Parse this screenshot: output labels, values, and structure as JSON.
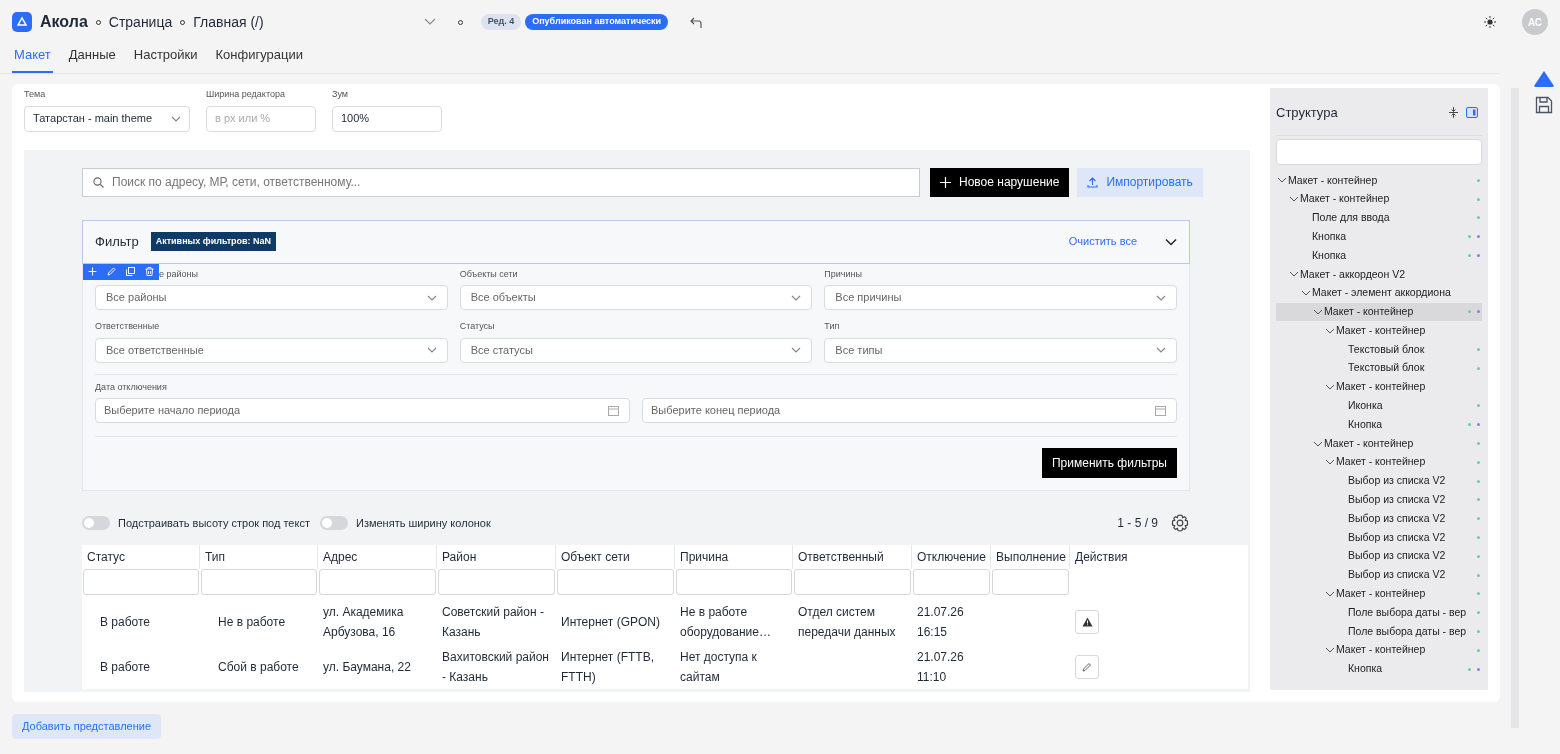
{
  "header": {
    "app_name": "Акола",
    "breadcrumbs": [
      "Страница",
      "Главная (/)"
    ],
    "revision": "Ред. 4",
    "status": "Опубликован автоматически",
    "avatar": "АС"
  },
  "tabs": [
    {
      "label": "Макет",
      "selected": true
    },
    {
      "label": "Данные",
      "selected": false
    },
    {
      "label": "Настройки",
      "selected": false
    },
    {
      "label": "Конфигурации",
      "selected": false
    }
  ],
  "editor_settings": [
    {
      "label": "Тема",
      "kind": "select",
      "value": "Татарстан - main theme"
    },
    {
      "label": "Ширина редактора",
      "kind": "input",
      "placeholder": "в px или %"
    },
    {
      "label": "Зум",
      "kind": "input",
      "value": "100%"
    }
  ],
  "canvas": {
    "search": {
      "placeholder": "Поиск по адресу, МР, сети, ответственному..."
    },
    "buttons": [
      {
        "label": "Новое нарушение",
        "kind": "primary"
      },
      {
        "label": "Импортировать",
        "kind": "secondary"
      }
    ],
    "filter": {
      "title": "Фильтр",
      "badge": "Активных фильтров: NaN",
      "clear": "Очистить все",
      "expanded": true,
      "fields": [
        {
          "label": "е районы",
          "placeholder": "Все районы"
        },
        {
          "label": "Объекты сети",
          "placeholder": "Все объекты"
        },
        {
          "label": "Причины",
          "placeholder": "Все причины"
        },
        {
          "label": "Ответственные",
          "placeholder": "Все ответственные"
        },
        {
          "label": "Статусы",
          "placeholder": "Все статусы"
        },
        {
          "label": "Тип",
          "placeholder": "Все типы"
        }
      ],
      "date": {
        "label": "Дата отключения",
        "fields": [
          {
            "placeholder": "Выберите начало периода"
          },
          {
            "placeholder": "Выберите конец периода"
          }
        ]
      },
      "apply": "Применить фильтры"
    },
    "toggles": [
      {
        "label": "Подстраивать высоту строк под текст",
        "on": false
      },
      {
        "label": "Изменять ширину колонок",
        "on": false
      }
    ],
    "pagination": "1 - 5 / 9",
    "table": {
      "columns": [
        "Статус",
        "Тип",
        "Адрес",
        "Район",
        "Объект сети",
        "Причина",
        "Ответственный",
        "Отключение",
        "Выполнение",
        "Действия"
      ],
      "rows": [
        {
          "cells": [
            "В работе",
            "Не в работе",
            "ул. Академика Арбузова, 16",
            "Советский район - Казань",
            "Интернет (GPON)",
            "Не в работе оборудование…",
            "Отдел систем передачи данных",
            "21.07.26 16:15",
            ""
          ],
          "kind": "warning"
        },
        {
          "cells": [
            "В работе",
            "Сбой в работе",
            "ул. Баумана, 22",
            "Вахитовский район - Казань",
            "Интернет (FTTB, FTTH)",
            "Нет доступа к сайтам",
            "",
            "21.07.26 11:10",
            ""
          ],
          "kind": "edit"
        }
      ]
    }
  },
  "structure": {
    "title": "Структура",
    "tree": [
      {
        "label": "Макет - контейнер",
        "expanded": true,
        "selected": false,
        "markers": [
          {
            "color": "#5fd3a8"
          }
        ],
        "children": [
          {
            "label": "Макет - контейнер",
            "expanded": true,
            "selected": false,
            "markers": [
              {
                "color": "#5fd3a8"
              }
            ],
            "children": [
              {
                "label": "Поле для ввода",
                "selected": false,
                "markers": [
                  {
                    "color": "#5fd3a8"
                  }
                ]
              },
              {
                "label": "Кнопка",
                "selected": false,
                "markers": [
                  {
                    "color": "#5fd3a8"
                  },
                  {
                    "color": "#8a7cf0"
                  }
                ]
              },
              {
                "label": "Кнопка",
                "selected": false,
                "markers": [
                  {
                    "color": "#5fd3a8"
                  },
                  {
                    "color": "#8a7cf0"
                  }
                ]
              }
            ]
          },
          {
            "label": "Макет - аккордеон V2",
            "expanded": true,
            "selected": false,
            "children": [
              {
                "label": "Макет - элемент аккордиона",
                "expanded": true,
                "selected": false,
                "children": [
                  {
                    "label": "Макет - контейнер",
                    "expanded": true,
                    "selected": true,
                    "markers": [
                      {
                        "color": "#5fd3a8"
                      },
                      {
                        "color": "#8a7cf0"
                      }
                    ],
                    "children": [
                      {
                        "label": "Макет - контейнер",
                        "expanded": true,
                        "selected": false,
                        "children": [
                          {
                            "label": "Текстовый блок",
                            "selected": false,
                            "markers": [
                              {
                                "color": "#5fd3a8"
                              }
                            ]
                          },
                          {
                            "label": "Текстовый блок",
                            "selected": false,
                            "markers": [
                              {
                                "color": "#5fd3a8"
                              }
                            ]
                          }
                        ]
                      },
                      {
                        "label": "Макет - контейнер",
                        "expanded": true,
                        "selected": false,
                        "children": [
                          {
                            "label": "Иконка",
                            "selected": false,
                            "markers": [
                              {
                                "color": "#5fd3a8"
                              }
                            ]
                          },
                          {
                            "label": "Кнопка",
                            "selected": false,
                            "markers": [
                              {
                                "color": "#5fd3a8"
                              },
                              {
                                "color": "#8a7cf0"
                              }
                            ]
                          }
                        ]
                      }
                    ]
                  },
                  {
                    "label": "Макет - контейнер",
                    "expanded": true,
                    "selected": false,
                    "markers": [
                      {
                        "color": "#5fd3a8"
                      }
                    ],
                    "children": [
                      {
                        "label": "Макет - контейнер",
                        "expanded": true,
                        "selected": false,
                        "markers": [
                          {
                            "color": "#5fd3a8"
                          }
                        ],
                        "children": [
                          {
                            "label": "Выбор из списка V2",
                            "selected": false,
                            "markers": [
                              {
                                "color": "#5fd3a8"
                              }
                            ]
                          },
                          {
                            "label": "Выбор из списка V2",
                            "selected": false,
                            "markers": [
                              {
                                "color": "#5fd3a8"
                              }
                            ]
                          },
                          {
                            "label": "Выбор из списка V2",
                            "selected": false,
                            "markers": [
                              {
                                "color": "#5fd3a8"
                              }
                            ]
                          },
                          {
                            "label": "Выбор из списка V2",
                            "selected": false,
                            "markers": [
                              {
                                "color": "#5fd3a8"
                              }
                            ]
                          },
                          {
                            "label": "Выбор из списка V2",
                            "selected": false,
                            "markers": [
                              {
                                "color": "#5fd3a8"
                              }
                            ]
                          },
                          {
                            "label": "Выбор из списка V2",
                            "selected": false,
                            "markers": [
                              {
                                "color": "#5fd3a8"
                              }
                            ]
                          }
                        ]
                      },
                      {
                        "label": "Макет - контейнер",
                        "expanded": true,
                        "selected": false,
                        "markers": [
                          {
                            "color": "#5fd3a8"
                          }
                        ],
                        "children": [
                          {
                            "label": "Поле выбора даты - вер",
                            "selected": false,
                            "markers": [
                              {
                                "color": "#5fd3a8"
                              }
                            ]
                          },
                          {
                            "label": "Поле выбора даты - вер",
                            "selected": false,
                            "markers": [
                              {
                                "color": "#5fd3a8"
                              }
                            ]
                          }
                        ]
                      },
                      {
                        "label": "Макет - контейнер",
                        "expanded": true,
                        "selected": false,
                        "markers": [
                          {
                            "color": "#5fd3a8"
                          }
                        ],
                        "children": [
                          {
                            "label": "Кнопка",
                            "selected": false,
                            "markers": [
                              {
                                "color": "#5fd3a8"
                              },
                              {
                                "color": "#8a7cf0"
                              }
                            ]
                          }
                        ]
                      }
                    ]
                  }
                ]
              }
            ]
          }
        ]
      }
    ]
  },
  "footer": {
    "button": "Добавить представление"
  }
}
